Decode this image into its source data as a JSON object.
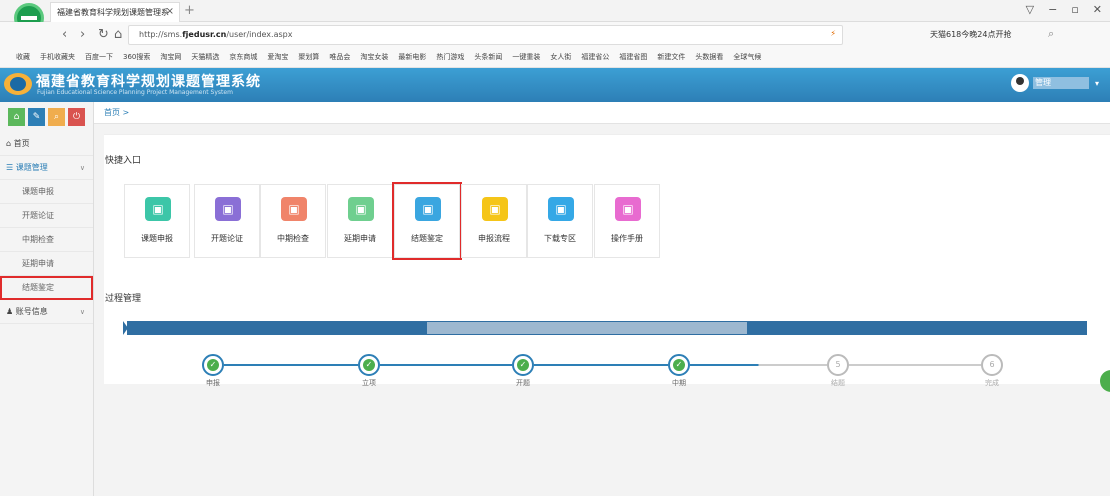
{
  "browser": {
    "tab_title": "福建省教育科学规划课题管理系",
    "tab_close": "×",
    "new_tab": "+",
    "url_prefix": "http://sms.",
    "url_domain": "fjedusr.cn",
    "url_path": "/user/index.aspx",
    "promo_text": "天猫618今晚24点开抢",
    "bookmarks": [
      "收藏",
      "手机收藏夹",
      "百度一下",
      "360搜索",
      "淘宝网",
      "天猫精选",
      "京东商城",
      "爱淘宝",
      "聚划算",
      "唯品会",
      "淘宝女装",
      "最新电影",
      "热门游戏",
      "头条新闻",
      "一键重装",
      "女人街",
      "福建省公",
      "福建省图",
      "新建文件",
      "头数据看",
      "全球气候"
    ]
  },
  "header": {
    "system_name": "福建省教育科学规划课题管理系统",
    "system_name_en": "Fujian Educational Science Planning Project Management System",
    "user_name": "管理"
  },
  "sidebar": {
    "home": "首页",
    "group1": "课题管理",
    "items": [
      "课题申报",
      "开题论证",
      "中期检查",
      "延期申请",
      "结题鉴定"
    ],
    "group2": "账号信息"
  },
  "breadcrumb": "首页 >",
  "quick": {
    "title": "快捷入口",
    "cards": [
      {
        "label": "课题申报",
        "color": "#3cc6a8"
      },
      {
        "label": "开题论证",
        "color": "#8a6fd6"
      },
      {
        "label": "中期检查",
        "color": "#f0846a"
      },
      {
        "label": "延期申请",
        "color": "#6fcf8f"
      },
      {
        "label": "结题鉴定",
        "color": "#3aa6e0"
      },
      {
        "label": "申报流程",
        "color": "#f5c518"
      },
      {
        "label": "下载专区",
        "color": "#35a8e6"
      },
      {
        "label": "操作手册",
        "color": "#e86bd0"
      }
    ]
  },
  "process": {
    "title": "过程管理",
    "steps": [
      {
        "label": "申报",
        "done": true,
        "num": "1"
      },
      {
        "label": "立项",
        "done": true,
        "num": "2"
      },
      {
        "label": "开题",
        "done": true,
        "num": "3"
      },
      {
        "label": "中期",
        "done": true,
        "num": "4"
      },
      {
        "label": "结题",
        "done": false,
        "num": "5"
      },
      {
        "label": "完成",
        "done": false,
        "num": "6"
      }
    ]
  },
  "colors": {
    "accent": "#2d7fb6",
    "highlight": "#e02b2b",
    "done": "#4cae4c"
  }
}
